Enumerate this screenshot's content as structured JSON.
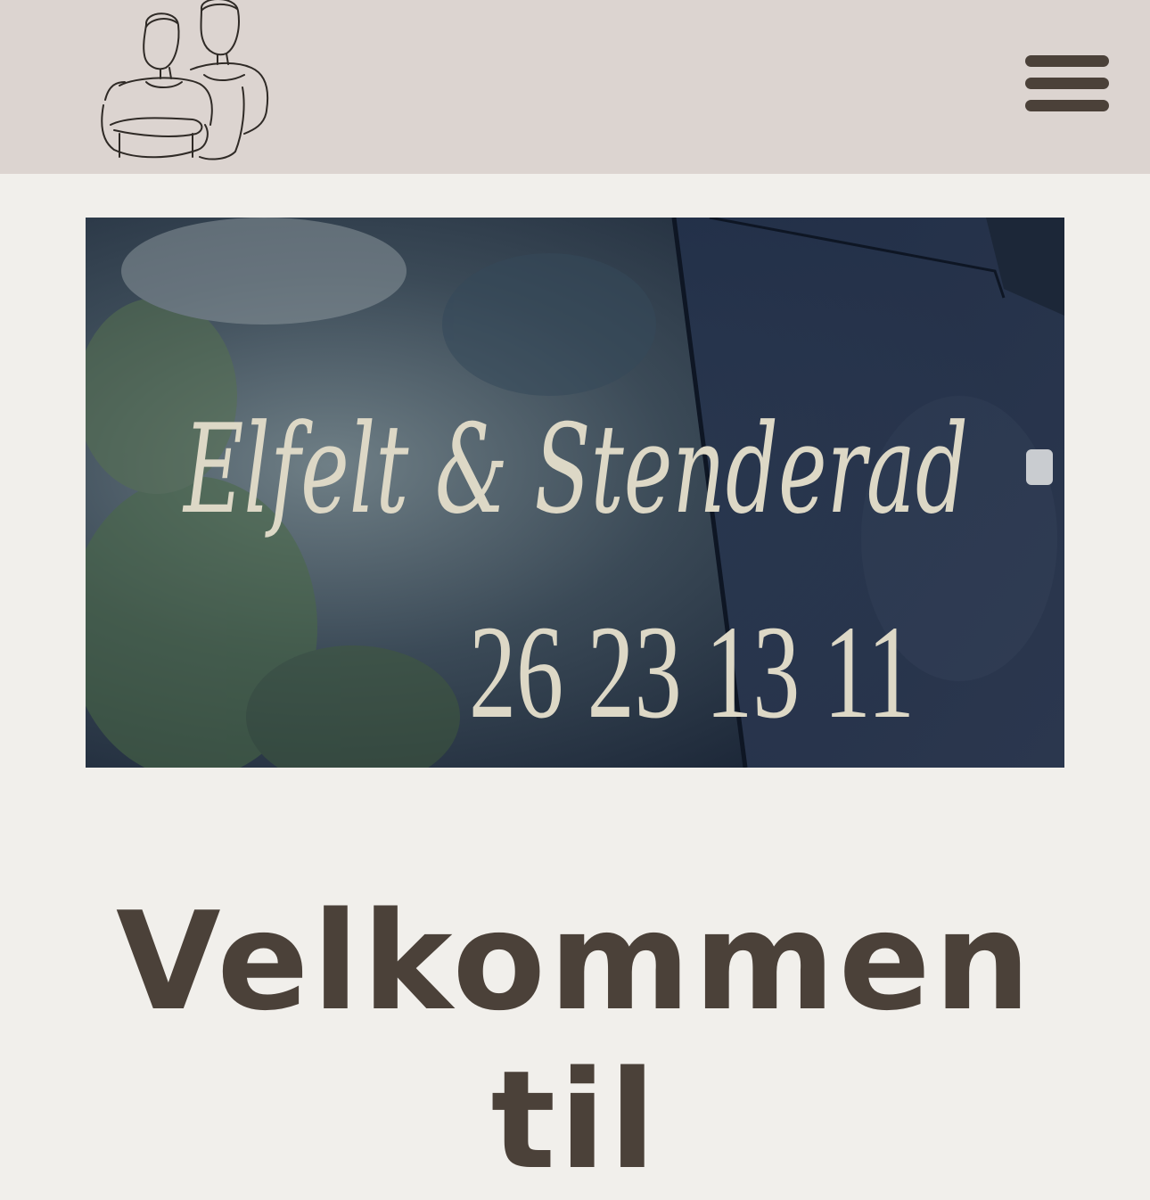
{
  "header": {
    "logo_icon": "two-men-line-drawing-logo",
    "menu_icon": "hamburger-menu-icon",
    "background_color": "#dcd4d0",
    "accent_color": "#4b4139"
  },
  "hero": {
    "van_text_line1": "Elfelt & Stenderad",
    "van_phone": "26 23 13 11"
  },
  "welcome": {
    "line1": "Velkommen",
    "line2": "til"
  }
}
